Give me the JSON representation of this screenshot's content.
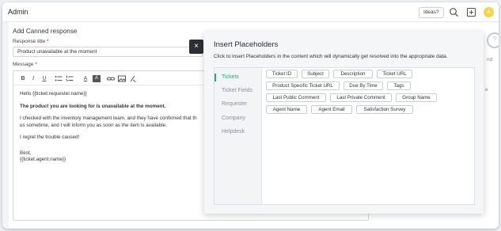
{
  "header": {
    "title": "Admin",
    "ideas_label": "Ideas?",
    "avatar_initial": "A"
  },
  "form": {
    "heading": "Add Canned response",
    "title_label": "Response title",
    "required_mark": "*",
    "title_value": "Product unavailable at the moment",
    "message_label": "Message",
    "message_lines": {
      "l1": "Hello {{ticket.requester.name}}",
      "l2": "The product you are looking for is unavailable at the moment.",
      "l3": "I checked with the inventory management team, and they have confirmed that th",
      "l4": "us sometime, and I will inform you as soon as the item is available.",
      "l5": "I regret the trouble caused!",
      "l6": "Best,",
      "l7": "{{ticket.agent.name}}"
    }
  },
  "toolbar_icons": [
    "bold-icon",
    "italic-icon",
    "underline-icon",
    "bullet-list-icon",
    "numbered-list-icon",
    "font-color-icon",
    "background-color-icon",
    "link-icon",
    "image-icon",
    "clear-format-icon"
  ],
  "toolbar": {
    "bold": "B",
    "italic": "I",
    "underline": "U",
    "font_color": "A",
    "bg_color": "A"
  },
  "close_label": "×",
  "modal": {
    "title": "Insert Placeholders",
    "description": "Click to insert Placeholders in the content which will dynamically get resolved into the appropriate data.",
    "categories": [
      "Tickets",
      "Ticket Fields",
      "Requester",
      "Company",
      "Helpdesk"
    ],
    "active_category": "Tickets",
    "placeholders": [
      "Ticket ID",
      "Subject",
      "Description",
      "Ticket URL",
      "Product Specific Ticket URL",
      "Due By Time",
      "Tags",
      "Last Public Comment",
      "Last Private Comment",
      "Group Name",
      "Agent Name",
      "Agent Email",
      "Satisfaction Survey"
    ]
  },
  "side_fragments": [
    "nd",
    "e"
  ],
  "colors": {
    "accent_green": "#2aaa6d",
    "required_red": "#d21f3c",
    "avatar_yellow": "#f6d443",
    "close_button_dark": "#2b2f36"
  }
}
